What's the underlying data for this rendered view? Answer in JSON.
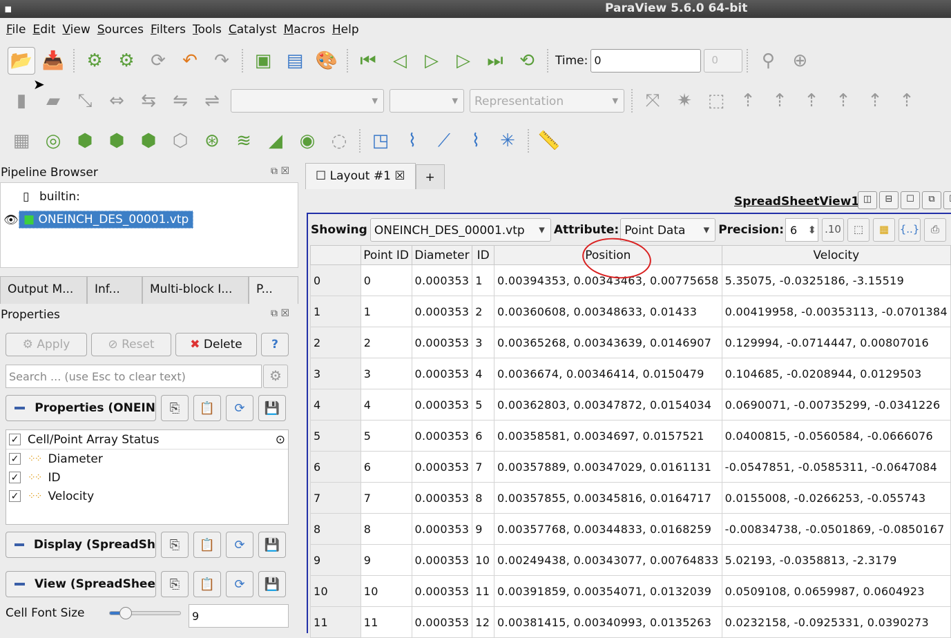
{
  "window": {
    "title": "ParaView 5.6.0 64-bit"
  },
  "menu": [
    "File",
    "Edit",
    "View",
    "Sources",
    "Filters",
    "Tools",
    "Catalyst",
    "Macros",
    "Help"
  ],
  "toolbar": {
    "time_label": "Time:",
    "time_value": "0",
    "time_step": "0",
    "representation_placeholder": "Representation"
  },
  "pipeline": {
    "title": "Pipeline Browser",
    "root": "builtin:",
    "source": "ONEINCH_DES_00001.vtp"
  },
  "left_tabs": [
    "Output M...",
    "Inf...",
    "Multi-block I...",
    "P..."
  ],
  "properties": {
    "title": "Properties",
    "apply": "Apply",
    "reset": "Reset",
    "delete": "Delete",
    "help": "?",
    "search_placeholder": "Search ... (use Esc to clear text)",
    "section_properties": "Properties (ONEIN",
    "array_status_title": "Cell/Point Array Status",
    "arrays": [
      "Diameter",
      "ID",
      "Velocity"
    ],
    "section_display": "Display (SpreadSh",
    "section_view": "View (SpreadShee",
    "cell_font_label": "Cell Font Size",
    "cell_font_value": "9",
    "cell_font_slider_fraction": 0.2
  },
  "layout": {
    "tab": "Layout #1",
    "plus": "+",
    "view_name": "SpreadSheetView1"
  },
  "spreadsheet": {
    "showing_label": "Showing",
    "showing_value": "ONEINCH_DES_00001.vtp",
    "attribute_label": "Attribute:",
    "attribute_value": "Point Data",
    "precision_label": "Precision:",
    "precision_value": "6",
    "columns": [
      "Point ID",
      "Diameter",
      "ID",
      "Position",
      "Velocity"
    ],
    "rows": [
      [
        "0",
        "0",
        "0.000353",
        "1",
        "0.00394353, 0.00343463, 0.00775658",
        "5.35075, -0.0325186, -3.15519"
      ],
      [
        "1",
        "1",
        "0.000353",
        "2",
        "0.00360608, 0.00348633, 0.01433",
        "0.00419958, -0.00353113, -0.0701384"
      ],
      [
        "2",
        "2",
        "0.000353",
        "3",
        "0.00365268, 0.00343639, 0.0146907",
        "0.129994, -0.0714447, 0.00807016"
      ],
      [
        "3",
        "3",
        "0.000353",
        "4",
        "0.0036674, 0.00346414, 0.0150479",
        "0.104685, -0.0208944, 0.0129503"
      ],
      [
        "4",
        "4",
        "0.000353",
        "5",
        "0.00362803, 0.00347872, 0.0154034",
        "0.0690071, -0.00735299, -0.0341226"
      ],
      [
        "5",
        "5",
        "0.000353",
        "6",
        "0.00358581, 0.0034697, 0.0157521",
        "0.0400815, -0.0560584, -0.0666076"
      ],
      [
        "6",
        "6",
        "0.000353",
        "7",
        "0.00357889, 0.00347029, 0.0161131",
        "-0.0547851, -0.0585311, -0.0647084"
      ],
      [
        "7",
        "7",
        "0.000353",
        "8",
        "0.00357855, 0.00345816, 0.0164717",
        "0.0155008, -0.0266253, -0.055743"
      ],
      [
        "8",
        "8",
        "0.000353",
        "9",
        "0.00357768, 0.00344833, 0.0168259",
        "-0.00834738, -0.0501869, -0.0850167"
      ],
      [
        "9",
        "9",
        "0.000353",
        "10",
        "0.00249438, 0.00343077, 0.00764833",
        "5.02193, -0.0358813, -2.3179"
      ],
      [
        "10",
        "10",
        "0.000353",
        "11",
        "0.00391859, 0.00354071, 0.0132039",
        "0.0509108, 0.0659987, 0.0604923"
      ],
      [
        "11",
        "11",
        "0.000353",
        "12",
        "0.00381415, 0.00340993, 0.0135263",
        "0.0232158, -0.0925331, 0.0390273"
      ]
    ]
  },
  "colors": {
    "selection": "#3d7fc6",
    "view_border": "#2230a8",
    "annotation": "#d92020"
  }
}
